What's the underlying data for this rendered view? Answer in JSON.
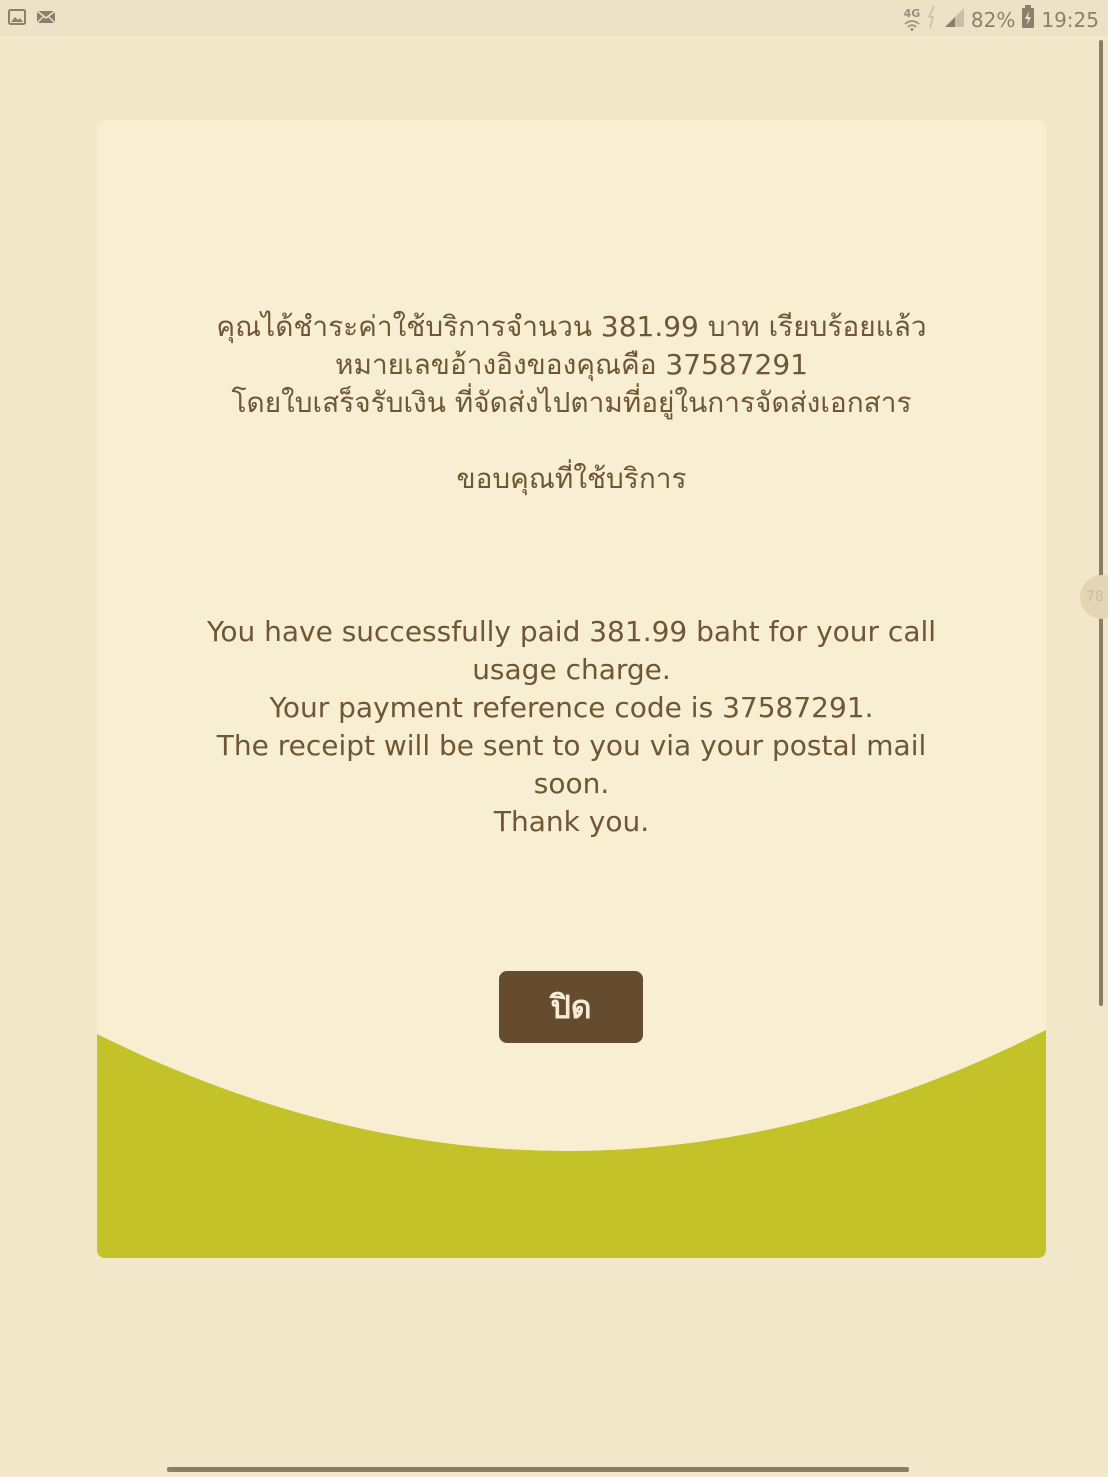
{
  "status_bar": {
    "network_type": "4G",
    "battery_percent": "82%",
    "time": "19:25",
    "left_icons": [
      "image-icon",
      "mail-icon"
    ],
    "right_icons": [
      "wifi-icon",
      "signal-icon",
      "battery-charging-icon"
    ]
  },
  "side_handle": {
    "label": "78"
  },
  "dialog": {
    "thai_message": [
      "คุณได้ชำระค่าใช้บริการจำนวน 381.99 บาท เรียบร้อยแล้ว",
      "หมายเลขอ้างอิงของคุณคือ 37587291",
      "โดยใบเสร็จรับเงิน ที่จัดส่งไปตามที่อยู่ในการจัดส่งเอกสาร"
    ],
    "thai_thanks": "ขอบคุณที่ใช้บริการ",
    "english_message": [
      "You have successfully paid 381.99 baht for your call usage charge.",
      "Your payment reference code is 37587291.",
      "The receipt will be sent to you via your postal mail soon."
    ],
    "english_thanks": "Thank you.",
    "close_button_label": "ปิด"
  },
  "colors": {
    "page_background": "#f2e7c9",
    "card_background": "#f8efd3",
    "wave_accent": "#c3c229",
    "text": "#6e5636",
    "button": "#654c2e",
    "button_text": "#f5ecd6"
  }
}
